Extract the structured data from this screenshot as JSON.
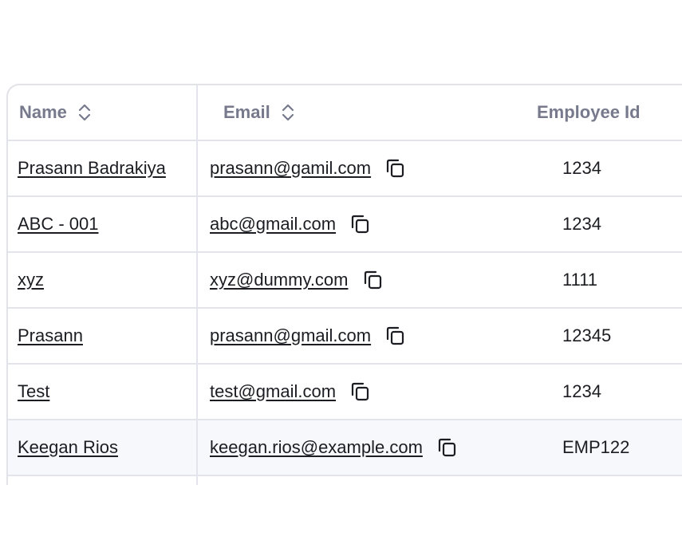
{
  "table": {
    "headers": {
      "name": "Name",
      "email": "Email",
      "employee_id": "Employee Id"
    },
    "rows": [
      {
        "name": "Prasann Badrakiya",
        "email": "prasann@gamil.com",
        "employee_id": "1234"
      },
      {
        "name": "ABC - 001",
        "email": "abc@gmail.com",
        "employee_id": "1234"
      },
      {
        "name": "xyz",
        "email": "xyz@dummy.com",
        "employee_id": "1111"
      },
      {
        "name": "Prasann",
        "email": "prasann@gmail.com",
        "employee_id": "12345"
      },
      {
        "name": "Test",
        "email": "test@gmail.com",
        "employee_id": "1234"
      },
      {
        "name": "Keegan Rios",
        "email": "keegan.rios@example.com",
        "employee_id": "EMP122"
      }
    ]
  },
  "icons": {
    "sort": "sort-updown-icon",
    "copy": "copy-icon"
  },
  "colors": {
    "header_text": "#777a8c",
    "border": "#e3e4ec",
    "row_highlight": "#f7f8fb",
    "text": "#1c1d22"
  }
}
